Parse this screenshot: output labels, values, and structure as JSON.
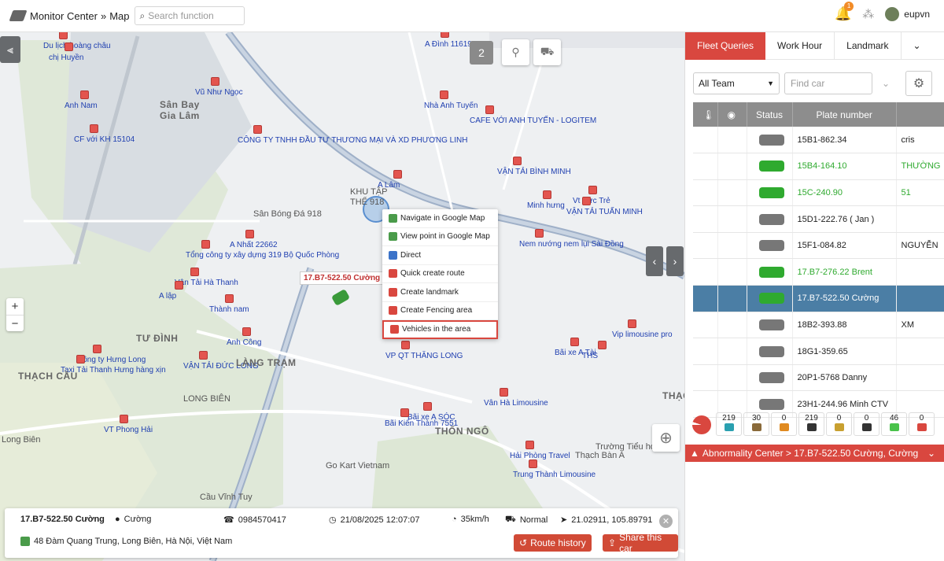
{
  "header": {
    "breadcrumb_root": "Monitor Center",
    "breadcrumb_sep": "»",
    "breadcrumb_page": "Map",
    "search_placeholder": "Search function",
    "notification_count": "1",
    "username": "eupvn"
  },
  "map": {
    "top_buttons": {
      "count": "2"
    },
    "labels": [
      {
        "text": "Du lịch hoàng châu",
        "cls": ""
      },
      {
        "text": "chị Huyền",
        "cls": ""
      },
      {
        "text": "Anh Nam",
        "cls": ""
      },
      {
        "text": "Sân Bay",
        "cls": "big"
      },
      {
        "text": "Gia Lâm",
        "cls": "big"
      },
      {
        "text": "Vũ Như Ngọc",
        "cls": ""
      },
      {
        "text": "CF với KH 15104",
        "cls": ""
      },
      {
        "text": "Nhà Anh Tuyến",
        "cls": ""
      },
      {
        "text": "CAFE VỚI ANH TUYẾN - LOGITEM",
        "cls": ""
      },
      {
        "text": "CÔNG TY TNHH ĐẦU TƯ THƯƠNG MẠI VÀ XD PHƯƠNG LINH",
        "cls": ""
      },
      {
        "text": "VẬN TẢI BÌNH MINH",
        "cls": ""
      },
      {
        "text": "A Lâm",
        "cls": ""
      },
      {
        "text": "KHU TẬP",
        "cls": "grey"
      },
      {
        "text": "THỂ 918",
        "cls": "grey"
      },
      {
        "text": "Sân Bóng Đá 918",
        "cls": "grey"
      },
      {
        "text": "Vt Sức Trẻ",
        "cls": ""
      },
      {
        "text": "Minh hưng",
        "cls": ""
      },
      {
        "text": "VẬN TẢI TUẤN MINH",
        "cls": ""
      },
      {
        "text": "A Nhất 22662",
        "cls": ""
      },
      {
        "text": "Tổng công ty xây dựng 319 Bộ Quốc Phòng",
        "cls": ""
      },
      {
        "text": "Nem nướng nem lụi Sài Đồng",
        "cls": ""
      },
      {
        "text": "Vận Tải Hà Thanh",
        "cls": ""
      },
      {
        "text": "A lập",
        "cls": ""
      },
      {
        "text": "Thành nam",
        "cls": ""
      },
      {
        "text": "Anh Công",
        "cls": ""
      },
      {
        "text": "TƯ ĐÌNH",
        "cls": "big"
      },
      {
        "text": "Công ty Hưng Long",
        "cls": ""
      },
      {
        "text": "Taxi Tải Thanh Hưng hàng xịn",
        "cls": ""
      },
      {
        "text": "VẬN TẢI ĐỨC LONG",
        "cls": ""
      },
      {
        "text": "LÀNG TRẠM",
        "cls": "big"
      },
      {
        "text": "THẠCH CẦU",
        "cls": "big"
      },
      {
        "text": "LONG BIÊN",
        "cls": "grey"
      },
      {
        "text": "VP QT THĂNG LONG",
        "cls": ""
      },
      {
        "text": "Bãi xe A Tài",
        "cls": ""
      },
      {
        "text": "THS",
        "cls": ""
      },
      {
        "text": "Vip limousine pro",
        "cls": ""
      },
      {
        "text": "Vân Hà Limousine",
        "cls": ""
      },
      {
        "text": "Bãi xe A SÓC",
        "cls": ""
      },
      {
        "text": "Bãi Kiến Thành 7551",
        "cls": ""
      },
      {
        "text": "THỐN NGÔ",
        "cls": "big"
      },
      {
        "text": "VT Phong Hải",
        "cls": ""
      },
      {
        "text": "Go Kart Vietnam",
        "cls": "grey"
      },
      {
        "text": "Trường Tiểu học",
        "cls": "grey"
      },
      {
        "text": "Thạch Bàn A",
        "cls": "grey"
      },
      {
        "text": "Hải Phòng Travel",
        "cls": ""
      },
      {
        "text": "Trung Thành Limousine",
        "cls": ""
      },
      {
        "text": "Cầu Vĩnh Tuy",
        "cls": "grey"
      },
      {
        "text": "THẠCH",
        "cls": "big"
      },
      {
        "text": "Long Biên",
        "cls": "grey"
      },
      {
        "text": "A Đình 11619",
        "cls": ""
      }
    ],
    "context_menu": [
      {
        "label": "Navigate in Google Map",
        "color": "#4a9b4a"
      },
      {
        "label": "View point in Google Map",
        "color": "#4a9b4a"
      },
      {
        "label": "Direct",
        "color": "#3b73c9"
      },
      {
        "label": "Quick create route",
        "color": "#d9473f"
      },
      {
        "label": "Create landmark",
        "color": "#d9473f"
      },
      {
        "label": "Create Fencing area",
        "color": "#d9473f"
      },
      {
        "label": "Vehicles in the area",
        "color": "#d9473f"
      }
    ],
    "car_marker_label": "17.B7-522.50 Cường"
  },
  "info": {
    "plate": "17.B7-522.50 Cường",
    "driver": "Cường",
    "phone": "0984570417",
    "datetime": "21/08/2025 12:07:07",
    "speed": "35km/h",
    "status": "Normal",
    "coords": "21.02911, 105.89791",
    "address": "48 Đàm Quang Trung, Long Biên, Hà Nội, Việt Nam",
    "route_history": "Route history",
    "share": "Share this car"
  },
  "panel": {
    "tabs": [
      "Fleet Queries",
      "Work Hour",
      "Landmark"
    ],
    "team_select": "All Team",
    "find_placeholder": "Find car",
    "columns": {
      "status": "Status",
      "plate": "Plate number"
    },
    "rows": [
      {
        "plate": "15B1-862.34",
        "extra": "cris",
        "green": false,
        "sel": false,
        "color": "#777"
      },
      {
        "plate": "15B4-164.10",
        "extra": "THƯỜNG",
        "green": true,
        "sel": false,
        "color": "#2faa2f"
      },
      {
        "plate": "15C-240.90",
        "extra": "51",
        "green": true,
        "sel": false,
        "color": "#2faa2f"
      },
      {
        "plate": "15D1-222.76 ( Jan )",
        "extra": "",
        "green": false,
        "sel": false,
        "color": "#777"
      },
      {
        "plate": "15F1-084.82",
        "extra": "NGUYỄN",
        "green": false,
        "sel": false,
        "color": "#777"
      },
      {
        "plate": "17.B7-276.22 Brent",
        "extra": "",
        "green": true,
        "sel": false,
        "color": "#2faa2f"
      },
      {
        "plate": "17.B7-522.50 Cường",
        "extra": "",
        "green": false,
        "sel": true,
        "color": "#2faa2f"
      },
      {
        "plate": "18B2-393.88",
        "extra": "XM",
        "green": false,
        "sel": false,
        "color": "#777"
      },
      {
        "plate": "18G1-359.65",
        "extra": "",
        "green": false,
        "sel": false,
        "color": "#777"
      },
      {
        "plate": "20P1-5768 Danny",
        "extra": "",
        "green": false,
        "sel": false,
        "color": "#777"
      },
      {
        "plate": "23H1-244.96 Minh CTV",
        "extra": "",
        "green": false,
        "sel": false,
        "color": "#777"
      }
    ],
    "stats": [
      {
        "value": "219",
        "color": "#2aa0b0"
      },
      {
        "value": "30",
        "color": "#8a6a3a"
      },
      {
        "value": "0",
        "color": "#e08a20"
      },
      {
        "value": "219",
        "color": "#333"
      },
      {
        "value": "0",
        "color": "#c8a030"
      },
      {
        "value": "0",
        "color": "#333"
      },
      {
        "value": "46",
        "color": "#49c24a"
      },
      {
        "value": "0",
        "color": "#d9473f"
      }
    ],
    "abnormality": "Abnormality Center > 17.B7-522.50 Cường, Cường"
  }
}
